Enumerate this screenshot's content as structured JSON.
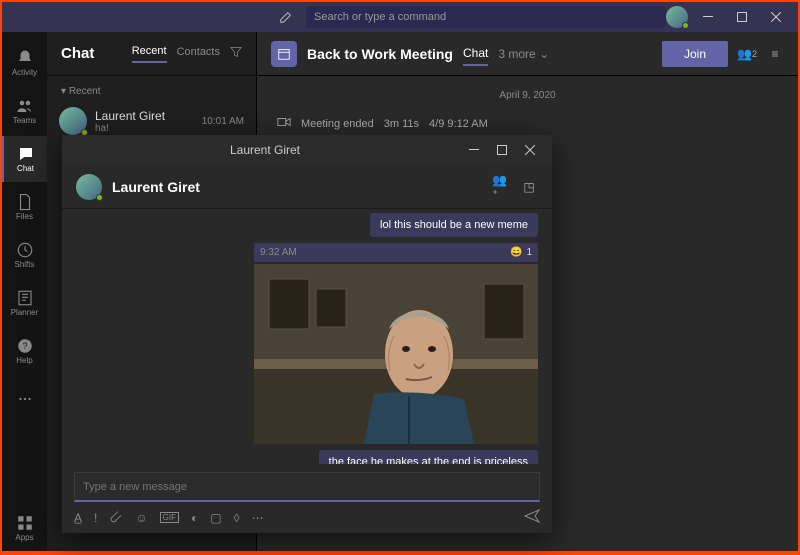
{
  "titlebar": {
    "search_placeholder": "Search or type a command"
  },
  "rail": {
    "activity": "Activity",
    "teams": "Teams",
    "chat": "Chat",
    "files": "Files",
    "shifts": "Shifts",
    "planner": "Planner",
    "help": "Help",
    "apps": "Apps"
  },
  "chatlist": {
    "title": "Chat",
    "tab_recent": "Recent",
    "tab_contacts": "Contacts",
    "section_recent": "Recent",
    "items": [
      {
        "name": "Laurent Giret",
        "preview": "ha!",
        "time": "10:01 AM"
      }
    ]
  },
  "content": {
    "meeting_title": "Back to Work Meeting",
    "tab_chat": "Chat",
    "tab_more": "3 more",
    "join": "Join",
    "participants_badge": "2",
    "date_separator": "April 9, 2020",
    "event_label": "Meeting ended",
    "event_duration": "3m 11s",
    "event_time": "4/9 9:12 AM"
  },
  "popout": {
    "title": "Laurent Giret",
    "name": "Laurent Giret",
    "msg_partial": "lol this should be a new meme",
    "msg_time": "9:32 AM",
    "reaction_count": "1",
    "msg_caption": "the face he makes at the end is priceless",
    "compose_placeholder": "Type a new message",
    "gif_label": "GIF"
  }
}
